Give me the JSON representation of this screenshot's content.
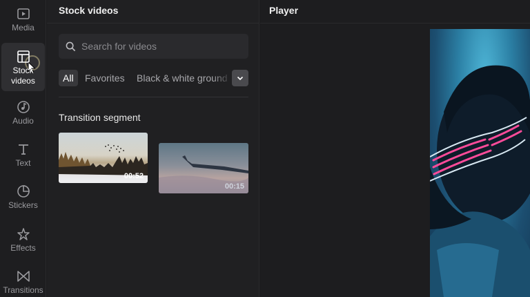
{
  "sidebar": {
    "items": [
      {
        "label": "Media",
        "icon": "media-icon",
        "active": false
      },
      {
        "label": "Stock\nvideos",
        "icon": "stock-videos-icon",
        "active": true
      },
      {
        "label": "Audio",
        "icon": "audio-icon",
        "active": false
      },
      {
        "label": "Text",
        "icon": "text-icon",
        "active": false
      },
      {
        "label": "Stickers",
        "icon": "stickers-icon",
        "active": false
      },
      {
        "label": "Effects",
        "icon": "effects-icon",
        "active": false
      },
      {
        "label": "Transitions",
        "icon": "transitions-icon",
        "active": false
      }
    ]
  },
  "panel": {
    "title": "Stock videos",
    "search_placeholder": "Search for videos",
    "filters": [
      "All",
      "Favorites",
      "Black & white ground"
    ],
    "section_title": "Transition segment",
    "videos": [
      {
        "duration": "00:52"
      },
      {
        "duration": "00:15"
      }
    ]
  },
  "player": {
    "title": "Player"
  },
  "colors": {
    "background": "#1b1b1d",
    "panel": "#202022",
    "active_tab": "#2f2f32",
    "text": "#e6e6e6",
    "muted": "#9a9a9e"
  }
}
